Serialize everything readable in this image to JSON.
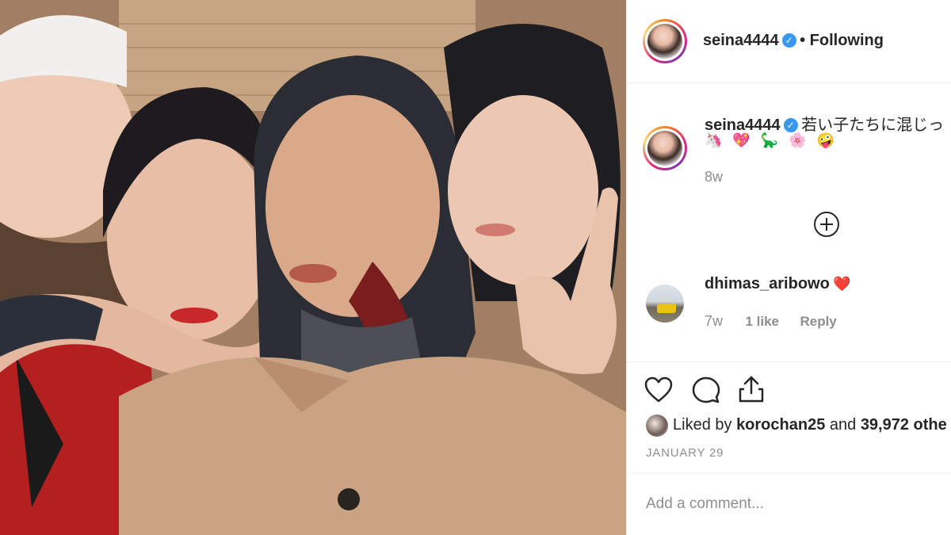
{
  "post": {
    "username": "seina4444",
    "following_label": "• Following"
  },
  "caption": {
    "username": "seina4444",
    "text": "若い子たちに混じっ",
    "emojis": "🦄 💖 🦕 🌸 🤪",
    "time": "8w"
  },
  "comment": {
    "username": "dhimas_aribowo",
    "text": "❤️",
    "time": "7w",
    "likes": "1 like",
    "reply_label": "Reply"
  },
  "likes": {
    "prefix": "Liked by ",
    "user": "korochan25",
    "middle": " and ",
    "count": "39,972 othe"
  },
  "date": "JANUARY 29",
  "add_comment_placeholder": "Add a comment...",
  "icons": {
    "verified": "verified-badge-icon",
    "like": "heart-icon",
    "comment": "speech-bubble-icon",
    "share": "share-icon",
    "load_more": "plus-circle-icon"
  },
  "colors": {
    "verified_blue": "#3897f0",
    "muted_text": "#8e8e8e",
    "heart_red": "#ed4956"
  }
}
